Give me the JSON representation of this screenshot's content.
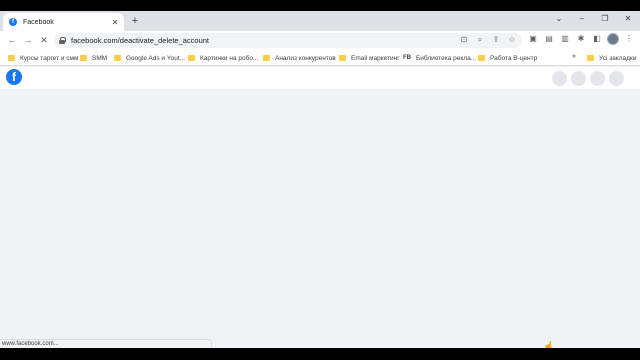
{
  "tab": {
    "title": "Facebook",
    "favicon": "facebook-icon"
  },
  "toolbar": {
    "url": "facebook.com/deactivate_delete_account"
  },
  "bookmarks": [
    {
      "label": "Курсы таргет и смм",
      "type": "folder"
    },
    {
      "label": "SMM",
      "type": "folder"
    },
    {
      "label": "Google Ads и Yout...",
      "type": "folder"
    },
    {
      "label": "Картинки на робо...",
      "type": "folder"
    },
    {
      "label": "Анализ конкурентов",
      "type": "folder"
    },
    {
      "label": "Email маркетинг",
      "type": "folder"
    },
    {
      "label": "Библиотека рекла...",
      "type": "fb"
    },
    {
      "label": "Работа B-центр",
      "type": "folder"
    },
    {
      "label": "Усі закладки",
      "type": "folder"
    }
  ],
  "bookmarks_more": "»",
  "page": {
    "logo_letter": "f"
  },
  "statusbar": {
    "text": "www.facebook.com..."
  },
  "colors": {
    "facebook_blue": "#1877f2",
    "page_bg": "#f0f2f5",
    "folder": "#f9cc4a"
  }
}
